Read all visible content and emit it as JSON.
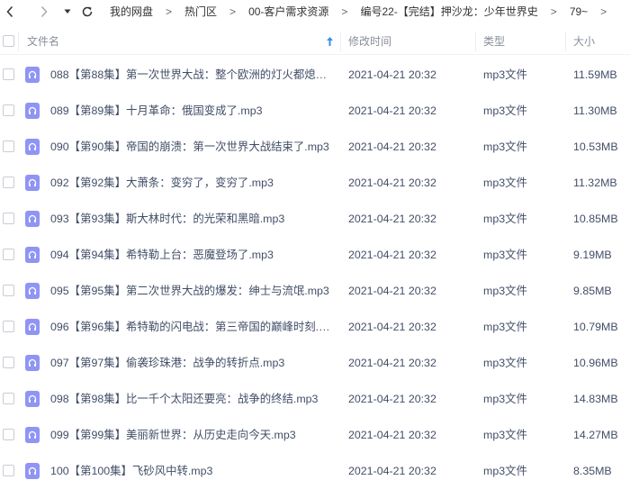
{
  "nav": {
    "back_icon": "chevron-left-icon",
    "forward_icon": "chevron-right-icon",
    "dropdown_icon": "caret-down-icon",
    "refresh_icon": "refresh-icon",
    "breadcrumbs": [
      "我的网盘",
      "热门区",
      "00-客户需求资源",
      "编号22-【完结】押沙龙：少年世界史",
      "79~"
    ],
    "separator": ">"
  },
  "header": {
    "name": "文件名",
    "sort_icon": "arrow-up-icon",
    "modified": "修改时间",
    "type": "类型",
    "size": "大小"
  },
  "colors": {
    "audio_icon": "#8f94f5",
    "sort_arrow": "#3a8ee6",
    "text": "#424e67",
    "header_text": "#888e9a"
  },
  "files": [
    {
      "name": "088【第88集】第一次世界大战：整个欧洲的灯火都熄灭...",
      "modified": "2021-04-21 20:32",
      "type": "mp3文件",
      "size": "11.59MB"
    },
    {
      "name": "089【第89集】十月革命：俄国变成了.mp3",
      "modified": "2021-04-21 20:32",
      "type": "mp3文件",
      "size": "11.30MB"
    },
    {
      "name": "090【第90集】帝国的崩溃：第一次世界大战结束了.mp3",
      "modified": "2021-04-21 20:32",
      "type": "mp3文件",
      "size": "10.53MB"
    },
    {
      "name": "092【第92集】大萧条：变穷了，变穷了.mp3",
      "modified": "2021-04-21 20:32",
      "type": "mp3文件",
      "size": "11.32MB"
    },
    {
      "name": "093【第93集】斯大林时代：的光荣和黑暗.mp3",
      "modified": "2021-04-21 20:32",
      "type": "mp3文件",
      "size": "10.85MB"
    },
    {
      "name": "094【第94集】希特勒上台：恶魔登场了.mp3",
      "modified": "2021-04-21 20:32",
      "type": "mp3文件",
      "size": "9.19MB"
    },
    {
      "name": "095【第95集】第二次世界大战的爆发：绅士与流氓.mp3",
      "modified": "2021-04-21 20:32",
      "type": "mp3文件",
      "size": "9.85MB"
    },
    {
      "name": "096【第96集】希特勒的闪电战：第三帝国的巅峰时刻.m...",
      "modified": "2021-04-21 20:32",
      "type": "mp3文件",
      "size": "10.79MB"
    },
    {
      "name": "097【第97集】偷袭珍珠港：战争的转折点.mp3",
      "modified": "2021-04-21 20:32",
      "type": "mp3文件",
      "size": "10.96MB"
    },
    {
      "name": "098【第98集】比一千个太阳还要亮：战争的终结.mp3",
      "modified": "2021-04-21 20:32",
      "type": "mp3文件",
      "size": "14.83MB"
    },
    {
      "name": "099【第99集】美丽新世界：从历史走向今天.mp3",
      "modified": "2021-04-21 20:32",
      "type": "mp3文件",
      "size": "14.27MB"
    },
    {
      "name": "100【第100集】飞砂风中转.mp3",
      "modified": "2021-04-21 20:32",
      "type": "mp3文件",
      "size": "8.35MB"
    }
  ]
}
